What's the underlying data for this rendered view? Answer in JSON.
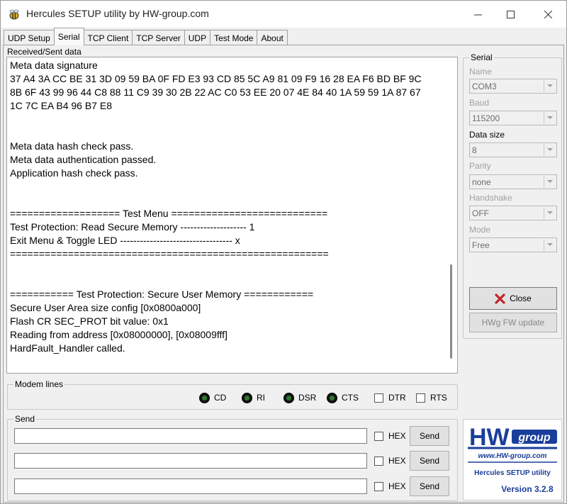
{
  "window": {
    "title": "Hercules SETUP utility by HW-group.com"
  },
  "tabs": [
    "UDP Setup",
    "Serial",
    "TCP Client",
    "TCP Server",
    "UDP",
    "Test Mode",
    "About"
  ],
  "received": {
    "label": "Received/Sent data",
    "lines": [
      "Meta data signature",
      "37 A4 3A CC BE 31 3D 09 59 BA 0F FD E3 93 CD 85 5C A9 81 09 F9 16 28 EA F6 BD BF 9C",
      "8B 6F 43 99 96 44 C8 88 11 C9 39 30 2B 22 AC C0 53 EE 20 07 4E 84 40 1A 59 59 1A 87 67",
      "1C 7C EA B4 96 B7 E8",
      "",
      "",
      "Meta data hash check pass.",
      "Meta data authentication passed.",
      "Application hash check pass.",
      "",
      "",
      "=================== Test Menu ===========================",
      "Test Protection: Read Secure Memory -------------------- 1",
      "Exit Menu & Toggle LED ---------------------------------- x",
      "=======================================================",
      "",
      "",
      "=========== Test Protection: Secure User Memory ============",
      "Secure User Area size config [0x0800a000]",
      "Flash CR SEC_PROT bit value: 0x1",
      "Reading from address [0x08000000], [0x08009fff]",
      "HardFault_Handler called."
    ]
  },
  "modem": {
    "title": "Modem lines",
    "leds": [
      "CD",
      "RI",
      "DSR",
      "CTS"
    ],
    "checks": [
      "DTR",
      "RTS"
    ]
  },
  "send": {
    "title": "Send",
    "hex_label": "HEX",
    "button_label": "Send"
  },
  "serial": {
    "title": "Serial",
    "name_label": "Name",
    "name_value": "COM3",
    "baud_label": "Baud",
    "baud_value": "115200",
    "datasize_label": "Data size",
    "datasize_value": "8",
    "parity_label": "Parity",
    "parity_value": "none",
    "handshake_label": "Handshake",
    "handshake_value": "OFF",
    "mode_label": "Mode",
    "mode_value": "Free",
    "close_label": "Close",
    "fw_label": "HWg FW update"
  },
  "logo": {
    "brand": "HW group",
    "url": "www.HW-group.com",
    "product": "Hercules SETUP utility",
    "version": "Version  3.2.8"
  },
  "colors": {
    "accent_blue": "#1a3e9b",
    "close_red": "#c0262c",
    "led_green": "#2c7a2c"
  }
}
